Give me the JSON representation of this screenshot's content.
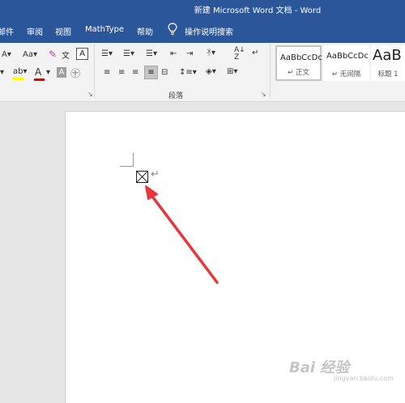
{
  "window": {
    "title": "新建 Microsoft Word 文档 - Word"
  },
  "tabs": [
    "邮件",
    "审阅",
    "视图",
    "MathType",
    "帮助"
  ],
  "tell_me": {
    "label": "操作说明搜索"
  },
  "font_group": {
    "font_size_btn": "Aa",
    "font_color_letter": "A",
    "shade_letter": "A",
    "highlight_letters": "ab",
    "border_letter": "A",
    "enclose_char": "㊉"
  },
  "paragraph_group": {
    "label": "段落",
    "sort_label": "A↓",
    "sort_sub": "Z"
  },
  "styles": [
    {
      "sample": "AaBbCcDc",
      "name": "↵ 正文"
    },
    {
      "sample": "AaBbCcDc",
      "name": "↵ 无间隔"
    },
    {
      "sample": "AaB",
      "name": "标题 1"
    }
  ],
  "document": {
    "paragraph_mark": "↵"
  },
  "watermark": {
    "text": "Bai 经验",
    "url": "jingyan.baidu.com"
  },
  "colors": {
    "title_bar": "#2b579a",
    "highlight": "#ffff00",
    "font_color": "#e00000",
    "arrow": "#e8363a"
  }
}
